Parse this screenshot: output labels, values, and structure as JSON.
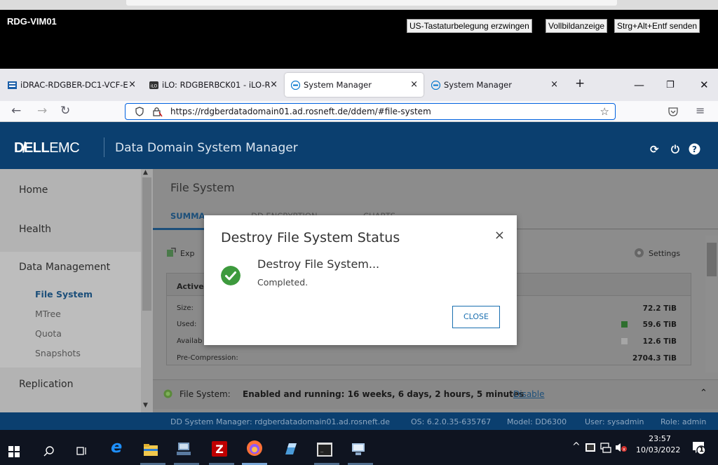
{
  "rdg": {
    "title": "RDG-VIM01",
    "buttons": [
      "US-Tastaturbelegung erzwingen",
      "Vollbildanzeige",
      "Strg+Alt+Entf senden"
    ]
  },
  "browser": {
    "tabs": [
      {
        "label": "iDRAC-RDGBER-DC1-VCF-E",
        "close": "×"
      },
      {
        "label": "iLO: RDGBERBCK01 - iLO-R",
        "close": "×"
      },
      {
        "label": "System Manager",
        "close": "×"
      },
      {
        "label": "System Manager",
        "close": "×"
      }
    ],
    "new_tab": "+",
    "url": "https://rdgberdatadomain01.ad.rosneft.de/ddem/#file-system"
  },
  "app": {
    "logo_bold": "D&#x2716;LL",
    "logo_text": "DELLEMC",
    "title": "Data Domain System Manager"
  },
  "sidebar": {
    "items": [
      "Home",
      "Health",
      "Data Management",
      "Replication"
    ],
    "sub_items": [
      "File System",
      "MTree",
      "Quota",
      "Snapshots"
    ]
  },
  "main": {
    "page_title": "File System",
    "tabs": [
      "SUMMA",
      "DD ENCRYPTION",
      "CHARTS"
    ],
    "export_label": "Exp",
    "settings_label": "Settings",
    "panel_header": "Active",
    "rows": [
      {
        "label": "Size:",
        "value": "72.2 TiB"
      },
      {
        "label": "Used:",
        "value": "59.6 TiB"
      },
      {
        "label": "Availab",
        "value": "12.6 TiB"
      },
      {
        "label": "Pre-Compression:",
        "value": "2704.3 TiB"
      }
    ],
    "status_label": "File System:",
    "status_value": "Enabled and running: 16 weeks, 6 days, 2 hours, 5 minutes",
    "disable_link": "Disable"
  },
  "footer": {
    "manager": "DD System Manager: rdgberdatadomain01.ad.rosneft.de",
    "os": "OS: 6.2.0.35-635767",
    "model": "Model: DD6300",
    "user": "User: sysadmin",
    "role": "Role: admin"
  },
  "modal": {
    "title": "Destroy File System Status",
    "close_x": "×",
    "line1": "Destroy File System...",
    "line2": "Completed.",
    "close_button": "CLOSE"
  },
  "taskbar": {
    "time": "23:57",
    "date": "10/03/2022",
    "notification_count": "1"
  },
  "colors": {
    "header": "#0b3f6f",
    "success": "#3d9a3d",
    "used_legend": "#2e8b2e"
  }
}
